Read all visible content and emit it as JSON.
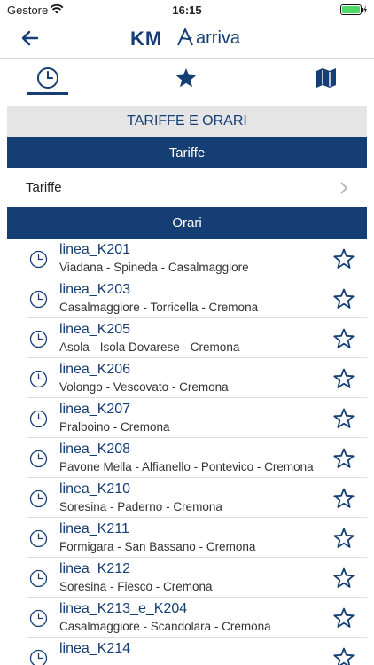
{
  "status_bar": {
    "carrier": "Gestore",
    "time": "16:15"
  },
  "header": {
    "logo_text": "KM",
    "brand_text": "arriva",
    "back_icon": "back-arrow-icon"
  },
  "tabs": [
    {
      "icon": "clock-icon",
      "active": true
    },
    {
      "icon": "star-icon",
      "active": false
    },
    {
      "icon": "map-icon",
      "active": false
    }
  ],
  "section": {
    "title": "TARIFFE E ORARI"
  },
  "tariffe": {
    "header": "Tariffe",
    "item_label": "Tariffe"
  },
  "orari": {
    "header": "Orari",
    "lines": [
      {
        "code": "linea_K201",
        "route": "Viadana - Spineda - Casalmaggiore"
      },
      {
        "code": "linea_K203",
        "route": "Casalmaggiore - Torricella - Cremona"
      },
      {
        "code": "linea_K205",
        "route": "Asola - Isola Dovarese - Cremona"
      },
      {
        "code": "linea_K206",
        "route": "Volongo - Vescovato - Cremona"
      },
      {
        "code": "linea_K207",
        "route": "Pralboino - Cremona"
      },
      {
        "code": "linea_K208",
        "route": "Pavone Mella - Alfianello - Pontevico - Cremona"
      },
      {
        "code": "linea_K210",
        "route": "Soresina - Paderno - Cremona"
      },
      {
        "code": "linea_K211",
        "route": "Formigara - San Bassano - Cremona"
      },
      {
        "code": "linea_K212",
        "route": "Soresina - Fiesco - Cremona"
      },
      {
        "code": "linea_K213_e_K204",
        "route": "Casalmaggiore - Scandolara - Cremona"
      },
      {
        "code": "linea_K214",
        "route": ""
      }
    ]
  },
  "colors": {
    "primary": "#153e74",
    "section_bg": "#e5e5e5",
    "battery": "#4cd964"
  }
}
